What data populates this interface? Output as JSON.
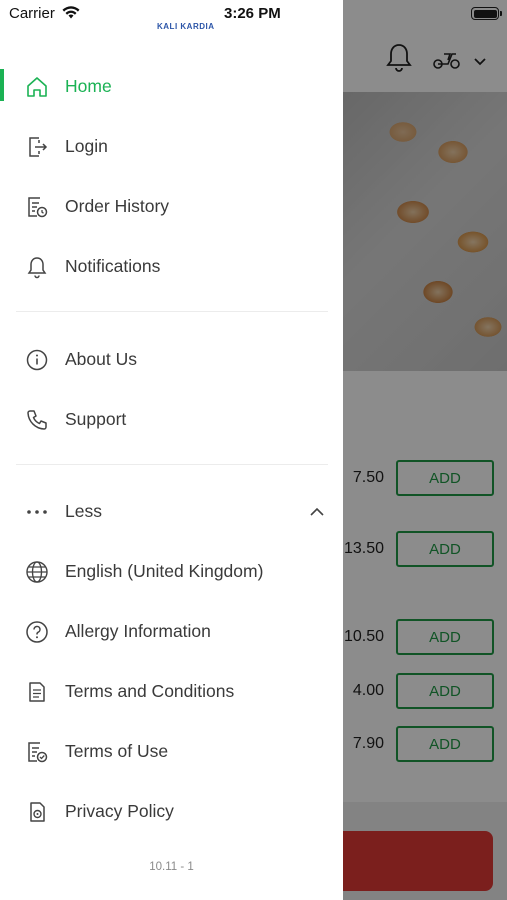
{
  "status_bar": {
    "carrier": "Carrier",
    "time": "3:26 PM"
  },
  "drawer": {
    "logo_text": "KALI KARDIA",
    "menu_primary": [
      {
        "label": "Home",
        "icon": "home-icon",
        "active": true
      },
      {
        "label": "Login",
        "icon": "login-icon"
      },
      {
        "label": "Order History",
        "icon": "order-history-icon"
      },
      {
        "label": "Notifications",
        "icon": "bell-icon"
      }
    ],
    "menu_secondary": [
      {
        "label": "About Us",
        "icon": "info-icon"
      },
      {
        "label": "Support",
        "icon": "phone-icon"
      }
    ],
    "less_toggle": {
      "label": "Less",
      "icon": "more-dots-icon",
      "expanded": true
    },
    "menu_more": [
      {
        "label": "English (United Kingdom)",
        "icon": "globe-icon"
      },
      {
        "label": "Allergy Information",
        "icon": "question-icon"
      },
      {
        "label": "Terms and Conditions",
        "icon": "document-icon"
      },
      {
        "label": "Terms of Use",
        "icon": "document-check-icon"
      },
      {
        "label": "Privacy Policy",
        "icon": "privacy-icon"
      }
    ],
    "version": "10.11 - 1"
  },
  "background": {
    "items": [
      {
        "price": "7.50",
        "add_label": "ADD"
      },
      {
        "price": "13.50",
        "add_label": "ADD"
      },
      {
        "price": "10.50",
        "add_label": "ADD"
      },
      {
        "price": "4.00",
        "add_label": "ADD"
      },
      {
        "price": "7.90",
        "add_label": "ADD"
      }
    ]
  },
  "colors": {
    "accent": "#1bb254",
    "add_button": "#1f9a45",
    "checkout": "#e03a35",
    "text": "#3a3a3a"
  }
}
